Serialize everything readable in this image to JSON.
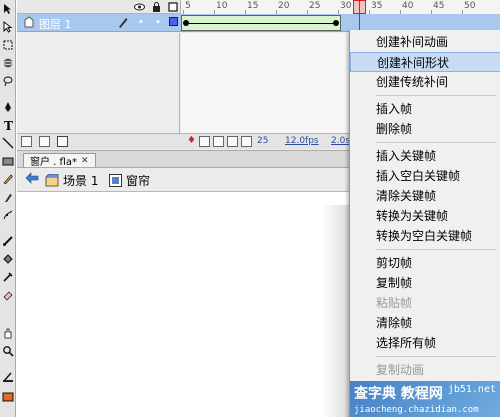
{
  "timeline": {
    "layer_name": "图层 1",
    "ruler_ticks": [
      "5",
      "10",
      "15",
      "20",
      "25",
      "30",
      "35",
      "40",
      "45",
      "50"
    ],
    "status": {
      "frame": "25",
      "fps": "12.0fps",
      "time": "2.0s"
    }
  },
  "document": {
    "tab_label": "窗户 . fla*",
    "scene_label": "场景 1",
    "symbol_label": "窗帘"
  },
  "context_menu": {
    "items": [
      {
        "label": "创建补间动画",
        "state": "normal"
      },
      {
        "label": "创建补间形状",
        "state": "highlighted"
      },
      {
        "label": "创建传统补间",
        "state": "normal"
      },
      {
        "label": "插入帧",
        "state": "normal"
      },
      {
        "label": "删除帧",
        "state": "normal"
      },
      {
        "label": "插入关键帧",
        "state": "normal"
      },
      {
        "label": "插入空白关键帧",
        "state": "normal"
      },
      {
        "label": "清除关键帧",
        "state": "normal"
      },
      {
        "label": "转换为关键帧",
        "state": "normal"
      },
      {
        "label": "转换为空白关键帧",
        "state": "normal"
      },
      {
        "label": "剪切帧",
        "state": "normal"
      },
      {
        "label": "复制帧",
        "state": "normal"
      },
      {
        "label": "粘贴帧",
        "state": "disabled"
      },
      {
        "label": "清除帧",
        "state": "normal"
      },
      {
        "label": "选择所有帧",
        "state": "normal"
      },
      {
        "label": "复制动画",
        "state": "disabled"
      }
    ]
  },
  "watermark": {
    "title": "查字典 教程网",
    "url": "jiaocheng.chazidian.com",
    "site": "jb51.net"
  },
  "colors": {
    "layer_selected": "#a9c8ee",
    "tween_span": "#d8f3d0",
    "playhead": "#e02020",
    "menu_highlight": "#c8dbf4"
  }
}
